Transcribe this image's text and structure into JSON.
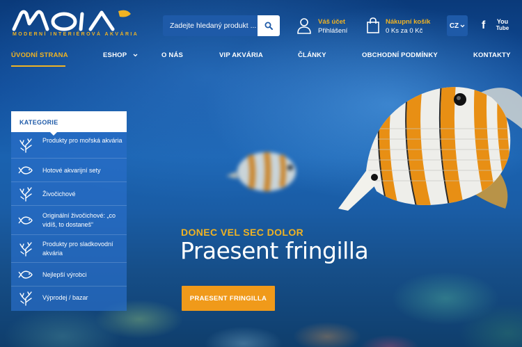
{
  "brand": {
    "logo_text": "MOIA",
    "tagline": "MODERNÍ INTERIÉROVÁ AKVÁRIA"
  },
  "colors": {
    "accent": "#f0b323",
    "button": "#f09a1a",
    "primary": "#1e5aa8"
  },
  "search": {
    "placeholder": "Zadejte hledaný produkt ...",
    "icon": "search-icon"
  },
  "account": {
    "title": "Váš účet",
    "subtitle": "Přihlášení",
    "icon": "user-icon"
  },
  "cart": {
    "title": "Nákupní košík",
    "subtitle": "0 Ks za 0 Kč",
    "icon": "shopping-bag-icon"
  },
  "language": {
    "selected": "CZ"
  },
  "social": {
    "facebook": "f",
    "youtube_top": "You",
    "youtube_bottom": "Tube"
  },
  "nav": {
    "items": [
      {
        "label": "ÚVODNÍ STRANA",
        "active": true
      },
      {
        "label": "ESHOP",
        "dropdown": true
      },
      {
        "label": "O NÁS"
      },
      {
        "label": "VIP AKVÁRIA"
      },
      {
        "label": "ČLÁNKY"
      },
      {
        "label": "OBCHODNÍ PODMÍNKY"
      },
      {
        "label": "KONTAKTY"
      }
    ]
  },
  "categories": {
    "title": "KATEGORIE",
    "items": [
      {
        "label": "Produkty pro mořská akvária",
        "icon": "coral-icon"
      },
      {
        "label": "Hotové akvarijní sety",
        "icon": "fish-icon"
      },
      {
        "label": "Živočichové",
        "icon": "coral-icon"
      },
      {
        "label": "Originální živočichové: „co vidíš, to dostaneš“",
        "icon": "fish-icon"
      },
      {
        "label": "Produkty pro sladkovodní akvária",
        "icon": "coral-icon"
      },
      {
        "label": "Nejlepší výrobci",
        "icon": "fish-icon"
      },
      {
        "label": "Výprodej / bazar",
        "icon": "coral-icon"
      }
    ]
  },
  "hero": {
    "subtitle": "DONEC VEL SEC DOLOR",
    "title": "Praesent fringilla",
    "button_label": "PRAESENT FRINGILLA"
  }
}
